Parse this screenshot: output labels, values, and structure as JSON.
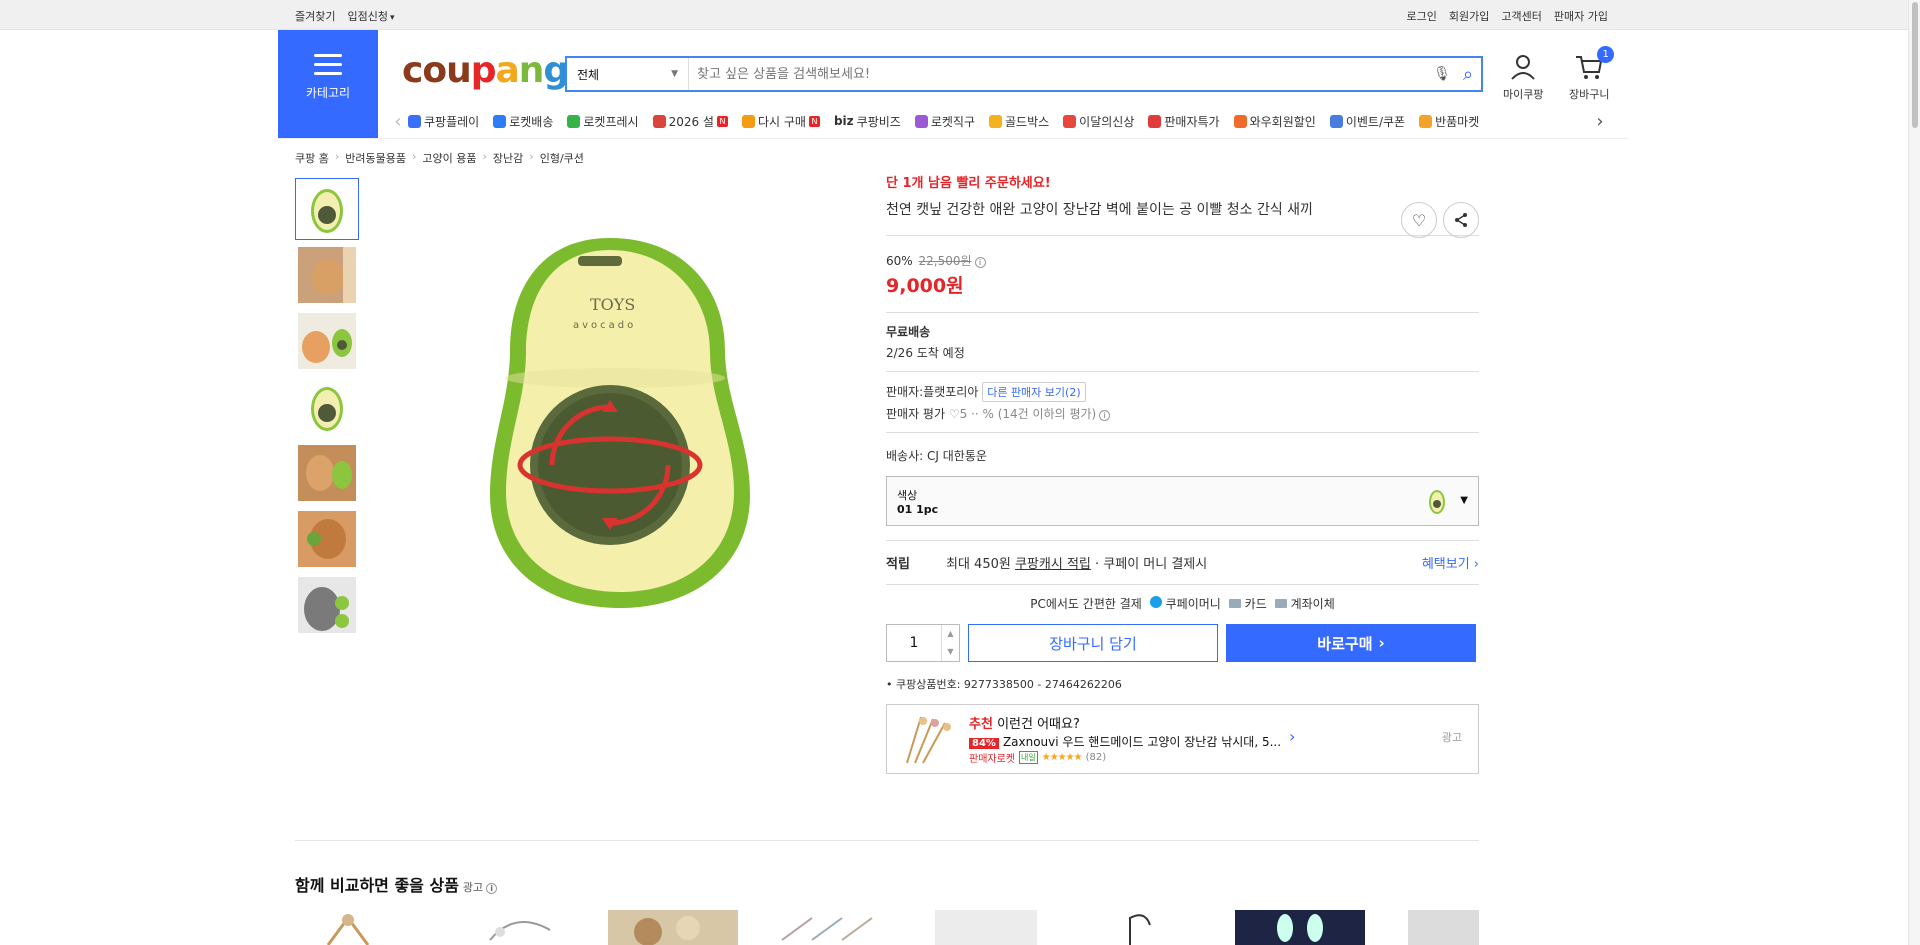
{
  "topbar": {
    "left": [
      "즐겨찾기",
      "입점신청"
    ],
    "right": [
      "로그인",
      "회원가입",
      "고객센터",
      "판매자 가입"
    ]
  },
  "header": {
    "category_label": "카테고리",
    "logo": [
      "cou",
      "p",
      "a",
      "n",
      "g"
    ],
    "search_select": "전체",
    "search_placeholder": "찾고 싶은 상품을 검색해보세요!",
    "mycoupang": "마이쿠팡",
    "cart": "장바구니",
    "cart_count": "1"
  },
  "nav": [
    {
      "label": "쿠팡플레이",
      "color": "#3a6ff7"
    },
    {
      "label": "로켓배송",
      "color": "#2d7df4"
    },
    {
      "label": "로켓프레시",
      "color": "#35b24a"
    },
    {
      "label": "2026 설",
      "color": "#d9453b",
      "badge": "N"
    },
    {
      "label": "다시 구매",
      "color": "#f39c12",
      "badge": "N"
    },
    {
      "label": "쿠팡비즈",
      "color": "#333333",
      "prefix": "biz"
    },
    {
      "label": "로켓직구",
      "color": "#9b59d6"
    },
    {
      "label": "골드박스",
      "color": "#f2b21b"
    },
    {
      "label": "이달의신상",
      "color": "#e8473f"
    },
    {
      "label": "판매자특가",
      "color": "#e03a3a"
    },
    {
      "label": "와우회원할인",
      "color": "#f06a2a"
    },
    {
      "label": "이벤트/쿠폰",
      "color": "#4a7be0"
    },
    {
      "label": "반품마켓",
      "color": "#f2a42a"
    }
  ],
  "breadcrumb": [
    "쿠팡 홈",
    "반려동물용품",
    "고양이 용품",
    "장난감",
    "인형/쿠션"
  ],
  "product": {
    "urgent": "단 1개 남음 빨리 주문하세요!",
    "title": "천연 캣닢 건강한 애완 고양이 장난감 벽에 붙이는 공 이빨 청소 간식 새끼",
    "discount": "60%",
    "original_price": "22,500원",
    "price": "9,000원",
    "shipping_title": "무료배송",
    "arrival": "2/26 도착 예정",
    "seller_label": "판매자:",
    "seller": "플랫포리아",
    "other_sellers": "다른 판매자 보기(2)",
    "seller_rating_label": "판매자 평가",
    "seller_rating": "♡5 ·· % (14건 이하의 평가)",
    "delivery_label": "배송사:",
    "delivery": "CJ 대한통운",
    "option_label": "색상",
    "option_value": "01 1pc",
    "reward_key": "적립",
    "reward_text_1": "최대 450원",
    "reward_text_2": "쿠팡캐시 적립",
    "reward_text_3": "· 쿠페이 머니 결제시",
    "reward_link": "혜택보기",
    "pc_pay": "PC에서도 간편한 결제",
    "pay_methods": [
      "쿠페이머니",
      "카드",
      "계좌이체"
    ],
    "qty": "1",
    "cart_btn": "장바구니 담기",
    "buy_btn": "바로구매",
    "product_id": "쿠팡상품번호: 9277338500 - 27464262206"
  },
  "recommend": {
    "label_red": "추천",
    "label": "이런건 어때요?",
    "discount": "84%",
    "title": "Zaxnouvi 우드 핸드메이드 고양이 장난감 낚시대, 5...",
    "badge": "판매자로켓",
    "tag": "내일",
    "stars": "★★★★★",
    "count": "(82)",
    "ad": "광고"
  },
  "compare": {
    "title": "함께 비교하면 좋을 상품",
    "ad": "광고"
  }
}
